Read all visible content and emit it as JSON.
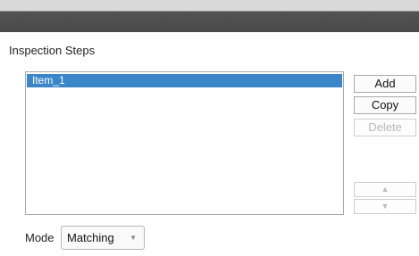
{
  "section": {
    "title": "Inspection Steps"
  },
  "steps": {
    "items": [
      "Item_1"
    ],
    "selected_index": 0
  },
  "buttons": {
    "add": "Add",
    "copy": "Copy",
    "delete": "Delete",
    "move_up_icon": "up-arrow-icon",
    "move_down_icon": "down-arrow-icon"
  },
  "mode": {
    "label": "Mode",
    "value": "Matching"
  },
  "colors": {
    "selection": "#3a86c8",
    "header_bar": "#4a4a4a"
  }
}
